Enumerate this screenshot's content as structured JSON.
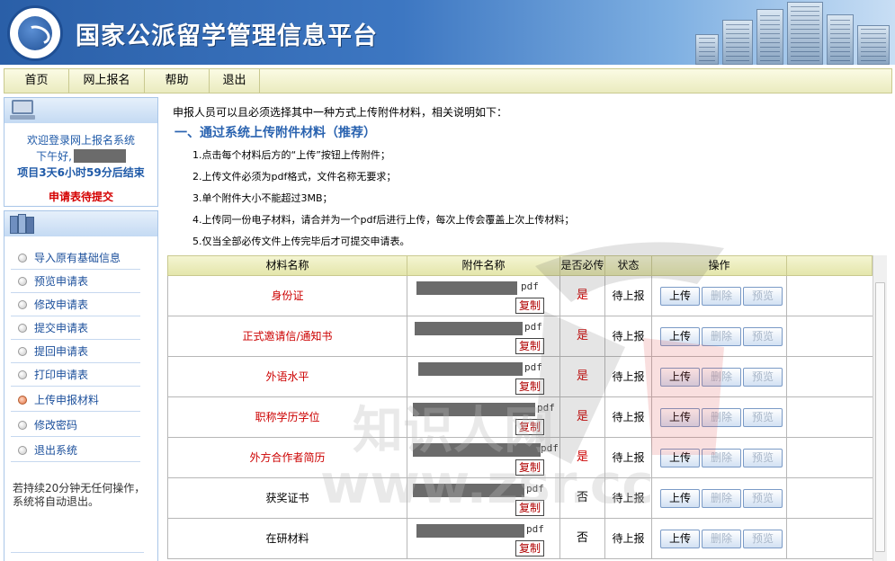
{
  "header": {
    "title": "国家公派留学管理信息平台"
  },
  "nav": {
    "items": [
      "首页",
      "网上报名",
      "帮助",
      "退出"
    ]
  },
  "sidebar": {
    "welcome": "欢迎登录网上报名系统",
    "greeting": "下午好,",
    "countdown": "项目3天6小时59分后结束",
    "status": "申请表待提交",
    "menu": [
      {
        "label": "导入原有基础信息",
        "active": false
      },
      {
        "label": "预览申请表",
        "active": false
      },
      {
        "label": "修改申请表",
        "active": false
      },
      {
        "label": "提交申请表",
        "active": false
      },
      {
        "label": "提回申请表",
        "active": false
      },
      {
        "label": "打印申请表",
        "active": false
      },
      {
        "label": "上传申报材料",
        "active": true
      },
      {
        "label": "修改密码",
        "active": false
      },
      {
        "label": "退出系统",
        "active": false
      }
    ],
    "idle_note": "若持续20分钟无任何操作，系统将自动退出。"
  },
  "main": {
    "intro": "申报人员可以且必须选择其中一种方式上传附件材料，相关说明如下：",
    "section_title": "一、通过系统上传附件材料（推荐）",
    "rules": [
      "1.点击每个材料后方的“上传”按钮上传附件；",
      "2.上传文件必须为pdf格式，文件名称无要求；",
      "3.单个附件大小不能超过3MB；",
      "4.上传同一份电子材料，请合并为一个pdf后进行上传，每次上传会覆盖上次上传材料；",
      "5.仅当全部必传文件上传完毕后才可提交申请表。"
    ],
    "table": {
      "headers": [
        "材料名称",
        "附件名称",
        "是否必传",
        "状态",
        "操作"
      ],
      "copy_label": "复制",
      "pdf_label": "pdf",
      "upload_label": "上传",
      "delete_label": "删除",
      "preview_label": "预览",
      "rows": [
        {
          "name": "身份证",
          "required": "是",
          "state": "待上报"
        },
        {
          "name": "正式邀请信/通知书",
          "required": "是",
          "state": "待上报"
        },
        {
          "name": "外语水平",
          "required": "是",
          "state": "待上报"
        },
        {
          "name": "职称学历学位",
          "required": "是",
          "state": "待上报"
        },
        {
          "name": "外方合作者简历",
          "required": "是",
          "state": "待上报"
        },
        {
          "name": "获奖证书",
          "required": "否",
          "state": "待上报"
        },
        {
          "name": "在研材料",
          "required": "否",
          "state": "待上报"
        }
      ]
    }
  },
  "watermark": {
    "line1": "知识人网",
    "line2": "www.zsr.cc"
  },
  "colors": {
    "accent_blue": "#2a63b0",
    "required_red": "#cc0000",
    "nav_bg": "#eaebbf"
  }
}
